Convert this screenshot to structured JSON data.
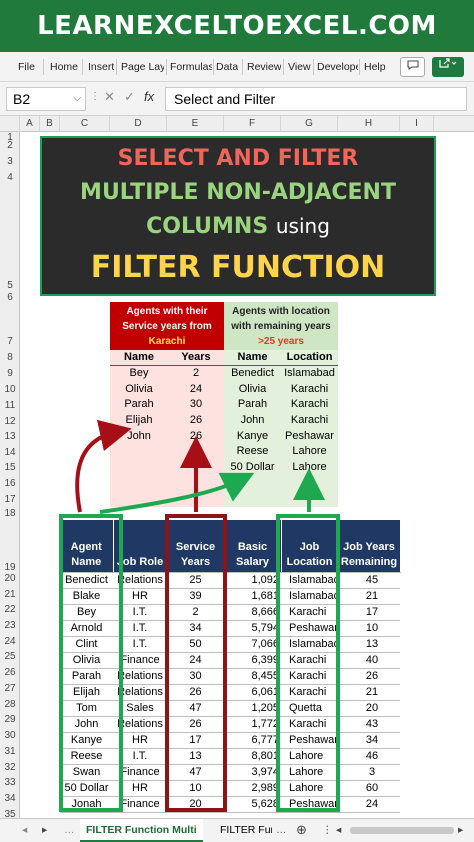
{
  "banner": "LEARNEXCELTOEXCEL.COM",
  "menu": [
    "File",
    "Home",
    "Insert",
    "Page Lay",
    "Formulas",
    "Data",
    "Review",
    "View",
    "Develope",
    "Help"
  ],
  "name_box": "B2",
  "formula_value": "Select and Filter",
  "fx_symbols": {
    "cancel": "✕",
    "enter": "✓",
    "fx": "fx"
  },
  "columns": [
    "A",
    "B",
    "C",
    "D",
    "E",
    "F",
    "G",
    "H",
    "I"
  ],
  "rows": [
    "1",
    "2",
    "3",
    "4",
    "5",
    "6",
    "7",
    "8",
    "9",
    "10",
    "11",
    "12",
    "13",
    "14",
    "15",
    "16",
    "17",
    "18",
    "19",
    "20",
    "21",
    "22",
    "23",
    "24",
    "25",
    "26",
    "27",
    "28",
    "29",
    "30",
    "31",
    "32",
    "33",
    "34",
    "35"
  ],
  "title": {
    "line1": "SELECT AND FILTER",
    "line2": "MULTIPLE NON-ADJACENT",
    "line3_main": "COLUMNS",
    "line3_small": "using",
    "line4": "FILTER FUNCTION"
  },
  "left_table": {
    "header_line1": "Agents with their",
    "header_line2": "Service years from",
    "header_city": "Karachi",
    "col1": "Name",
    "col2": "Years",
    "rows": [
      [
        "Bey",
        "2"
      ],
      [
        "Olivia",
        "24"
      ],
      [
        "Parah",
        "30"
      ],
      [
        "Elijah",
        "26"
      ],
      [
        "John",
        "26"
      ]
    ]
  },
  "right_table": {
    "header_line1": "Agents with location",
    "header_line2": "with remaining years",
    "header_cond": ">25 years",
    "col1": "Name",
    "col2": "Location",
    "rows": [
      [
        "Benedict",
        "Islamabad"
      ],
      [
        "Olivia",
        "Karachi"
      ],
      [
        "Parah",
        "Karachi"
      ],
      [
        "John",
        "Karachi"
      ],
      [
        "Kanye",
        "Peshawar"
      ],
      [
        "Reese",
        "Lahore"
      ],
      [
        "50 Dollar",
        "Lahore"
      ]
    ]
  },
  "main_table": {
    "headers": [
      "Agent Name",
      "Job Role",
      "Service Years",
      "Basic Salary",
      "Job Location",
      "Job Years Remaining"
    ],
    "rows": [
      [
        "Benedict",
        "Relations",
        "25",
        "1,092",
        "Islamabad",
        "45"
      ],
      [
        "Blake",
        "HR",
        "39",
        "1,681",
        "Islamabad",
        "21"
      ],
      [
        "Bey",
        "I.T.",
        "2",
        "8,666",
        "Karachi",
        "17"
      ],
      [
        "Arnold",
        "I.T.",
        "34",
        "5,794",
        "Peshawar",
        "10"
      ],
      [
        "Clint",
        "I.T.",
        "50",
        "7,066",
        "Islamabad",
        "13"
      ],
      [
        "Olivia",
        "Finance",
        "24",
        "6,399",
        "Karachi",
        "40"
      ],
      [
        "Parah",
        "Relations",
        "30",
        "8,455",
        "Karachi",
        "26"
      ],
      [
        "Elijah",
        "Relations",
        "26",
        "6,061",
        "Karachi",
        "21"
      ],
      [
        "Tom",
        "Sales",
        "47",
        "1,205",
        "Quetta",
        "20"
      ],
      [
        "John",
        "Relations",
        "26",
        "1,772",
        "Karachi",
        "43"
      ],
      [
        "Kanye",
        "HR",
        "17",
        "6,777",
        "Peshawar",
        "34"
      ],
      [
        "Reese",
        "I.T.",
        "13",
        "8,801",
        "Lahore",
        "46"
      ],
      [
        "Swan",
        "Finance",
        "47",
        "3,974",
        "Lahore",
        "3"
      ],
      [
        "50 Dollar",
        "HR",
        "10",
        "2,989",
        "Lahore",
        "60"
      ],
      [
        "Jonah",
        "Finance",
        "20",
        "5,628",
        "Peshawar",
        "24"
      ]
    ]
  },
  "sheet_tabs": {
    "active": "FILTER Function Multi",
    "other": "FILTER Fun"
  },
  "colors": {
    "excel_green": "#1f7a3c",
    "dark_red": "#a50f15",
    "green_box": "#1ea84f",
    "header_navy": "#1f3864"
  }
}
